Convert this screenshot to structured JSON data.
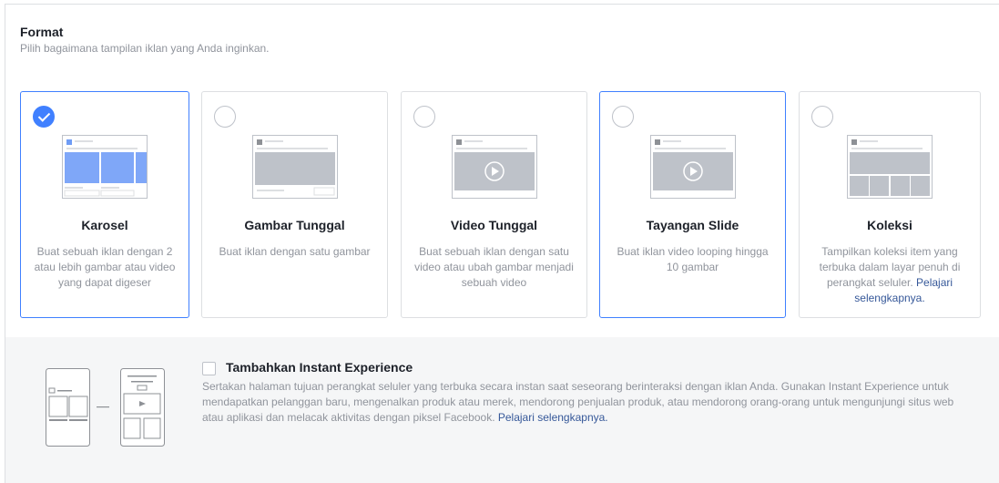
{
  "format": {
    "title": "Format",
    "subtitle": "Pilih bagaimana tampilan iklan yang Anda inginkan."
  },
  "cards": [
    {
      "name": "Karosel",
      "desc": "Buat sebuah iklan dengan 2 atau lebih gambar atau video yang dapat digeser",
      "selected": true
    },
    {
      "name": "Gambar Tunggal",
      "desc": "Buat iklan dengan satu gambar",
      "selected": false
    },
    {
      "name": "Video Tunggal",
      "desc": "Buat sebuah iklan dengan satu video atau ubah gambar menjadi sebuah video",
      "selected": false
    },
    {
      "name": "Tayangan Slide",
      "desc": "Buat iklan video looping hingga 10 gambar",
      "selected": false
    },
    {
      "name": "Koleksi",
      "desc": "Tampilkan koleksi item yang terbuka dalam layar penuh di perangkat seluler.",
      "link": "Pelajari selengkapnya.",
      "selected": false
    }
  ],
  "instant_experience": {
    "title": "Tambahkan Instant Experience",
    "desc": "Sertakan halaman tujuan perangkat seluler yang terbuka secara instan saat seseorang berinteraksi dengan iklan Anda. Gunakan Instant Experience untuk mendapatkan pelanggan baru, mengenalkan produk atau merek, mendorong penjualan produk, atau mendorong orang-orang untuk mengunjungi situs web atau aplikasi dan melacak aktivitas dengan piksel Facebook.",
    "link": "Pelajari selengkapnya.",
    "checked": false
  },
  "colors": {
    "accent": "#4080ff",
    "link": "#365899",
    "muted_text": "#90949c",
    "panel_bg": "#f5f6f7"
  }
}
